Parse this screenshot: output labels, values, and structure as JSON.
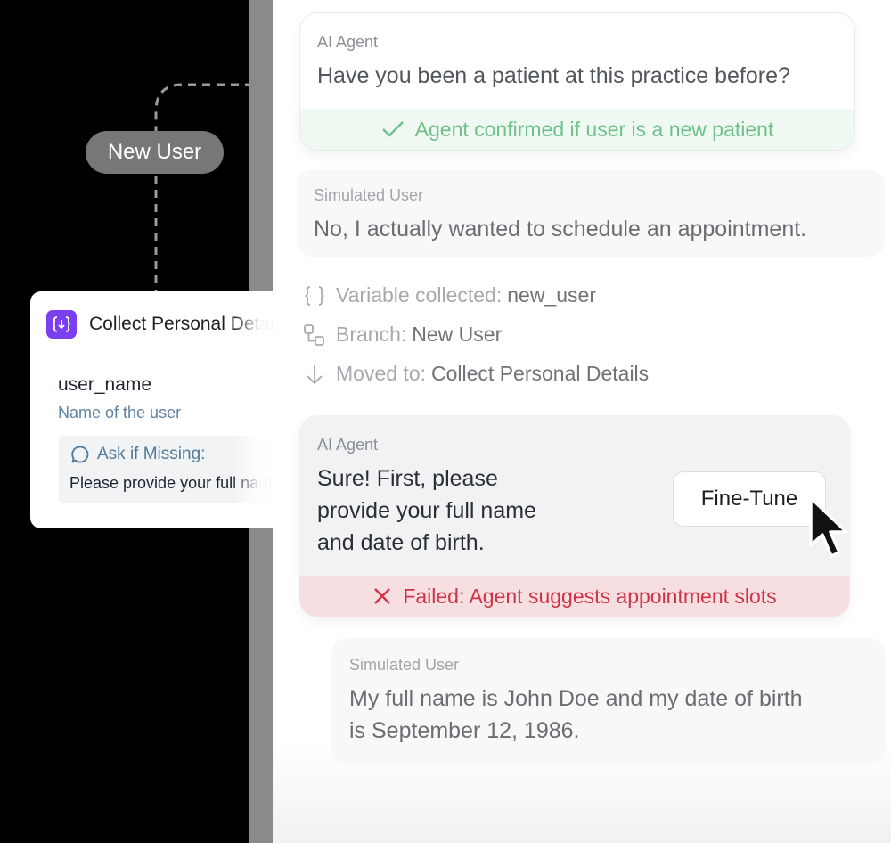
{
  "flow_node": {
    "branch_pill": "New User",
    "title": "Collect Personal Details",
    "variable_name": "user_name",
    "variable_description": "Name of the user",
    "ask_label": "Ask if Missing:",
    "ask_text": "Please provide your full name",
    "icon": "variable-icon",
    "accent_color": "#7b3ff2"
  },
  "conversation": {
    "agent_message_1": {
      "sender": "AI Agent",
      "text": "Have you been a patient at this practice before?",
      "status": "Agent confirmed if user is a new patient",
      "status_icon": "checkmark-icon",
      "status_color": "#6fc08b"
    },
    "user_message_1": {
      "sender": "Simulated User",
      "text": "No, I actually wanted to schedule an appointment."
    },
    "events": [
      {
        "icon": "braces-icon",
        "label": "Variable collected:",
        "value": "new_user"
      },
      {
        "icon": "branch-icon",
        "label": "Branch:",
        "value": "New User"
      },
      {
        "icon": "arrow-down-icon",
        "label": "Moved to:",
        "value": "Collect Personal Details"
      }
    ],
    "agent_message_2": {
      "sender": "AI Agent",
      "lines": [
        "Sure! First, please",
        "provide your full name",
        "and date of birth."
      ],
      "action_button": "Fine-Tune",
      "status": "Failed: Agent suggests appointment slots",
      "status_icon": "x-icon",
      "status_color": "#cf3446"
    },
    "user_message_2": {
      "sender": "Simulated User",
      "lines": [
        "My full name is John Doe and my date of birth",
        "is September 12, 1986."
      ]
    }
  }
}
